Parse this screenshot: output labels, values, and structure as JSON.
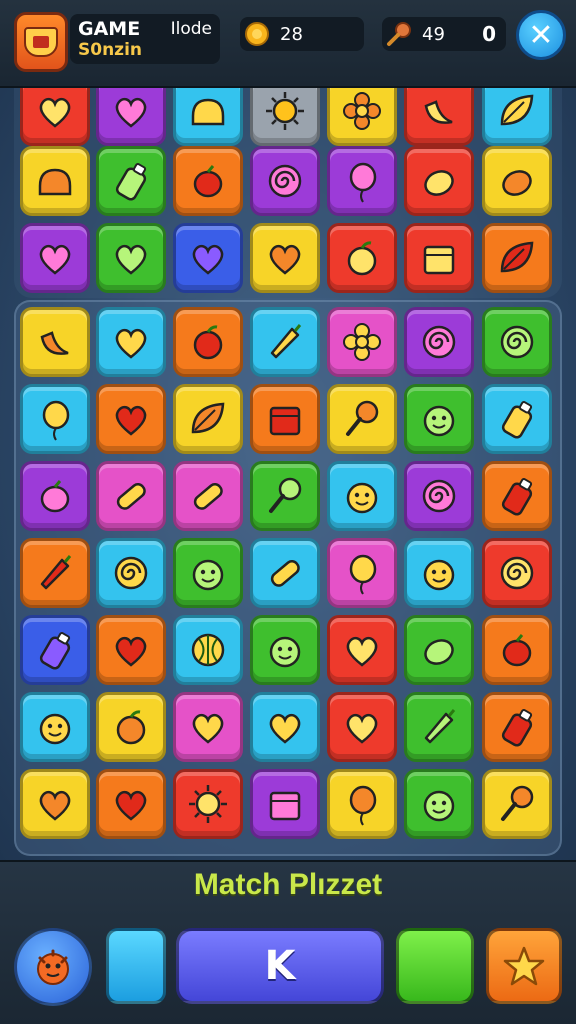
{
  "header": {
    "title": "GAME",
    "mode": "Ilode",
    "subtitle": "S0nzin",
    "coins": "28",
    "gems": "49",
    "gems_secondary": "0",
    "close_label": "✕"
  },
  "footer": {
    "game_name": "Match Plızzet",
    "main_button_label": "K"
  },
  "board": {
    "columns": 7,
    "rows": [
      [
        "red:heart",
        "purple:heart",
        "cyan:bread",
        "gray:sun",
        "yellow:flower",
        "red:banana",
        "cyan:leaf"
      ],
      [
        "yellow:bread",
        "green:bottle",
        "orange:fruit",
        "purple:swirl",
        "purple:balloon",
        "red:lemon",
        "yellow:lemon"
      ],
      [
        "purple:heart",
        "green:heart",
        "blue:heart",
        "yellow:heart",
        "red:apple",
        "red:box",
        "orange:leaf"
      ],
      [
        "yellow:banana",
        "cyan:heart",
        "orange:apple",
        "cyan:carrot",
        "pink:flower",
        "purple:swirl",
        "green:swirl"
      ],
      [
        "cyan:balloon",
        "orange:heart",
        "yellow:leaf",
        "orange:box",
        "yellow:lolly",
        "green:face",
        "cyan:bottle"
      ],
      [
        "purple:fruit",
        "pink:candy",
        "pink:candy",
        "green:lolly",
        "cyan:face",
        "purple:swirl",
        "orange:bottle"
      ],
      [
        "orange:carrot",
        "cyan:swirl",
        "green:face",
        "cyan:candy",
        "pink:balloon",
        "cyan:face",
        "red:swirl"
      ],
      [
        "blue:bottle",
        "orange:heart",
        "cyan:melon",
        "green:face",
        "red:heart",
        "green:lemon",
        "orange:fruit"
      ],
      [
        "cyan:face",
        "yellow:apple",
        "pink:heart",
        "cyan:heart",
        "red:heart",
        "green:carrot",
        "orange:bottle"
      ],
      [
        "yellow:heart",
        "orange:heart",
        "red:sun",
        "purple:box",
        "yellow:balloon",
        "green:face",
        "yellow:lolly"
      ]
    ]
  },
  "colors": {
    "red": "#ee3a2c",
    "purple": "#9c3bd8",
    "cyan": "#34c3ee",
    "gray": "#9aa3ad",
    "yellow": "#f7d428",
    "green": "#3fbf2e",
    "orange": "#f57a1c",
    "blue": "#3a5ee8",
    "pink": "#e552c8"
  },
  "icons": {
    "badge": "shield-badge-icon",
    "coins": "coin-icon",
    "gems": "key-gem-icon",
    "close": "close-icon",
    "pet": "creature-icon",
    "star": "star-icon"
  }
}
